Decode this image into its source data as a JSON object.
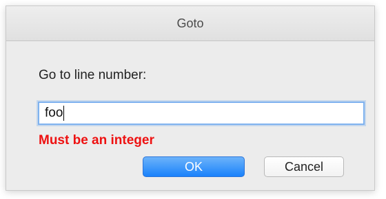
{
  "dialog": {
    "title": "Goto",
    "prompt": "Go to line number:",
    "input_value": "foo",
    "error_message": "Must be an integer",
    "ok_label": "OK",
    "cancel_label": "Cancel"
  },
  "colors": {
    "error": "#ee1111",
    "default_button": "#1a82fb",
    "focus_ring": "#7fb2ef"
  }
}
